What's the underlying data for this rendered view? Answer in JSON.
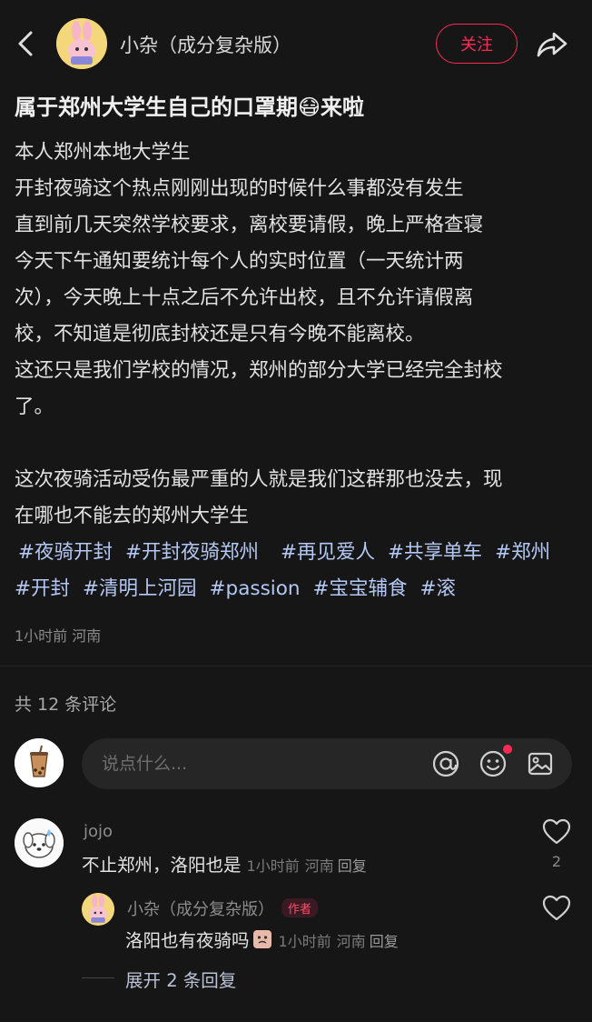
{
  "header": {
    "author_name": "小杂（成分复杂版）",
    "follow_label": "关注"
  },
  "post": {
    "title": "属于郑州大学生自己的口罩期😷来啦",
    "lines": [
      "本人郑州本地大学生",
      "开封夜骑这个热点刚刚出现的时候什么事都没有发生",
      "直到前几天突然学校要求，离校要请假，晚上严格查寝",
      "今天下午通知要统计每个人的实时位置（一天统计两",
      "次），今天晚上十点之后不允许出校，且不允许请假离",
      "校，不知道是彻底封校还是只有今晚不能离校。",
      "这还只是我们学校的情况，郑州的部分大学已经完全封校",
      "了。",
      "",
      "这次夜骑活动受伤最严重的人就是我们这群那也没去，现",
      "在哪也不能去的郑州大学生"
    ],
    "tags": [
      "#夜骑开封",
      "#开封夜骑郑州",
      "#再见爱人",
      "#共享单车",
      "#郑州",
      "#开封",
      "#清明上河园",
      "#passion",
      "#宝宝辅食",
      "#滚"
    ],
    "time": "1小时前",
    "location": "河南"
  },
  "comments_section": {
    "count_label": "共 12 条评论",
    "input_placeholder": "说点什么...",
    "icons": [
      "at-icon",
      "emoji-icon",
      "image-icon"
    ]
  },
  "comments": [
    {
      "user": "jojo",
      "text": "不止郑州，洛阳也是",
      "time": "1小时前",
      "location": "河南",
      "reply_label": "回复",
      "likes": "2"
    }
  ],
  "reply": {
    "user": "小杂（成分复杂版）",
    "badge": "作者",
    "text": "洛阳也有夜骑吗",
    "time": "1小时前",
    "location": "河南",
    "reply_label": "回复"
  },
  "expand_label": "展开 2 条回复",
  "colors": {
    "background": "#161616",
    "accent": "#ff2a55",
    "tag": "#b4c8f5"
  }
}
